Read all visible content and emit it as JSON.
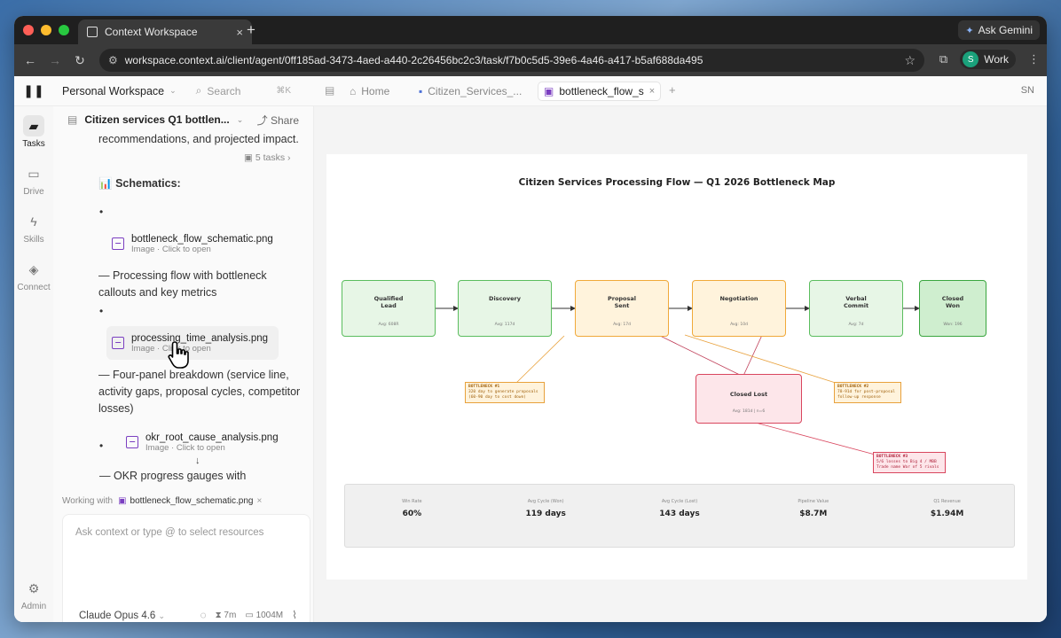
{
  "browser": {
    "tab_title": "Context Workspace",
    "tab_close": "×",
    "new_tab": "+",
    "ask_gemini": "Ask Gemini",
    "url": "workspace.context.ai/client/agent/0ff185ad-3473-4aed-a440-2c26456bc2c3/task/f7b0c5d5-39e6-4a46-a417-b5af688da495",
    "profile_initial": "S",
    "profile_name": "Work"
  },
  "app_header": {
    "workspace": "Personal Workspace",
    "search_placeholder": "Search",
    "search_shortcut": "⌘K",
    "tabs": [
      {
        "label": "Home"
      },
      {
        "label": "Citizen_Services_..."
      },
      {
        "label": "bottleneck_flow_s"
      }
    ],
    "user_initials": "SN"
  },
  "rail": {
    "items": [
      {
        "label": "Tasks",
        "icon": "chat-icon"
      },
      {
        "label": "Drive",
        "icon": "folder-icon"
      },
      {
        "label": "Skills",
        "icon": "bolt-icon"
      },
      {
        "label": "Connect",
        "icon": "layers-icon"
      },
      {
        "label": "Admin",
        "icon": "gear-icon"
      }
    ]
  },
  "chat": {
    "title": "Citizen services Q1 bottlen...",
    "share": "Share",
    "tasks_count": "5 tasks",
    "intro": "recommendations, and projected impact.",
    "schematics_heading": "Schematics:",
    "schematics_emoji": "📊",
    "bullet": "•",
    "files": [
      {
        "name": "bottleneck_flow_schematic.png",
        "sub": "Image · Click to open"
      },
      {
        "name": "processing_time_analysis.png",
        "sub": "Image · Click to open"
      },
      {
        "name": "okr_root_cause_analysis.png",
        "sub": "Image · Click to open"
      }
    ],
    "desc1": "— Processing flow with bottleneck callouts and key metrics",
    "desc2": "— Four-panel breakdown (service line, activity gaps, proposal cycles, competitor losses)",
    "desc3": "— OKR progress gauges with",
    "working_with_label": "Working with",
    "working_with_file": "bottleneck_flow_schematic.png",
    "composer_placeholder": "Ask context or type @ to select resources",
    "model": "Claude Opus 4.6",
    "time": "7m",
    "tokens": "1004M"
  },
  "diagram": {
    "title": "Citizen Services Processing Flow — Q1 2026 Bottleneck Map",
    "nodes": [
      {
        "label": "Qualified\nLead",
        "sub": "Avg: 608R"
      },
      {
        "label": "Discovery",
        "sub": "Avg: 117d"
      },
      {
        "label": "Proposal\nSent",
        "sub": "Avg: 17d"
      },
      {
        "label": "Negotiation",
        "sub": "Avg: 10d"
      },
      {
        "label": "Verbal\nCommit",
        "sub": "Avg: 7d"
      },
      {
        "label": "Closed\nWon",
        "sub": "Won: 196"
      },
      {
        "label": "Closed Lost",
        "sub": "Avg: 181d | n=6"
      }
    ],
    "callouts": [
      {
        "head": "BOTTLENECK #1",
        "body": "320 day to generate proposals (60-90 day to cost down)"
      },
      {
        "head": "BOTTLENECK #2",
        "body": "78-91d for post-proposal follow-up response"
      },
      {
        "head": "BOTTLENECK #3",
        "body": "5/6 losses to Big 4 / MBB Trade name War of 5 rivals"
      }
    ],
    "metrics": [
      {
        "label": "Win Rate",
        "value": "60%"
      },
      {
        "label": "Avg Cycle (Won)",
        "value": "119 days"
      },
      {
        "label": "Avg Cycle (Lost)",
        "value": "143 days"
      },
      {
        "label": "Pipeline Value",
        "value": "$8.7M"
      },
      {
        "label": "Q1 Revenue",
        "value": "$1.94M"
      }
    ]
  }
}
